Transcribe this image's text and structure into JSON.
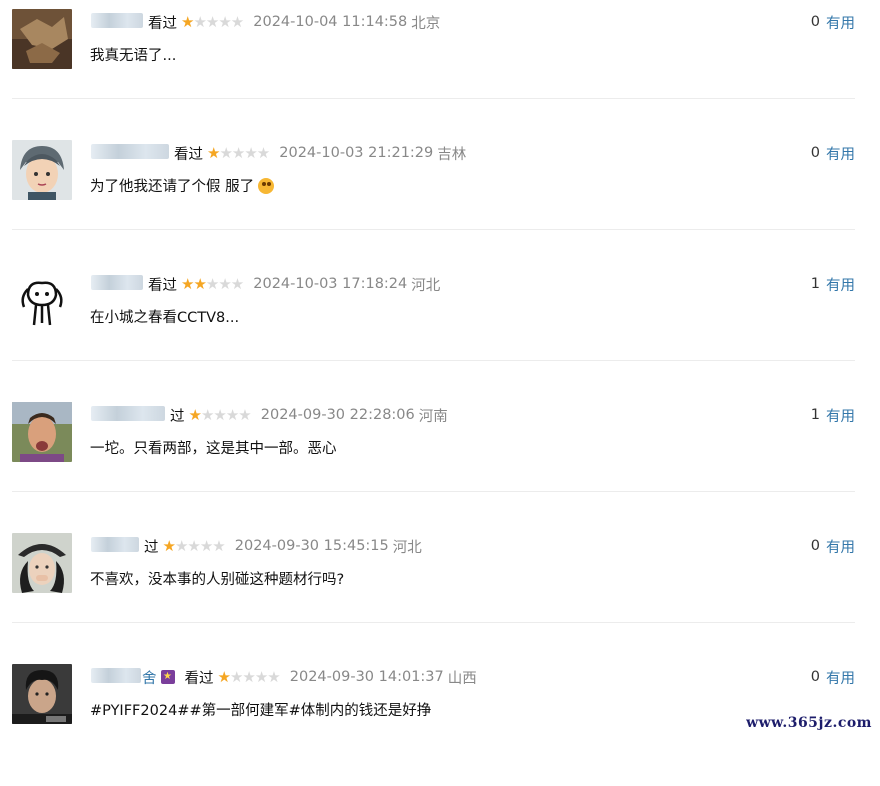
{
  "reviews": [
    {
      "name_visible": "",
      "status": "看过",
      "rating": 1,
      "time": "2024-10-04 11:14:58",
      "location": "北京",
      "votes": "0",
      "vote_label": "有用",
      "comment": "我真无语了..."
    },
    {
      "name_visible": "",
      "status": "看过",
      "rating": 1,
      "time": "2024-10-03 21:21:29",
      "location": "吉林",
      "votes": "0",
      "vote_label": "有用",
      "comment": "为了他我还请了个假 服了"
    },
    {
      "name_visible": "",
      "status": "看过",
      "rating": 2,
      "time": "2024-10-03 17:18:24",
      "location": "河北",
      "votes": "1",
      "vote_label": "有用",
      "comment": "在小城之春看CCTV8..."
    },
    {
      "name_visible": "",
      "status": "过",
      "rating": 1,
      "time": "2024-09-30 22:28:06",
      "location": "河南",
      "votes": "1",
      "vote_label": "有用",
      "comment": "一坨。只看两部，这是其中一部。恶心"
    },
    {
      "name_visible": "",
      "status": "过",
      "rating": 1,
      "time": "2024-09-30 15:45:15",
      "location": "河北",
      "votes": "0",
      "vote_label": "有用",
      "comment": "不喜欢，没本事的人别碰这种题材行吗?"
    },
    {
      "name_visible": "舍",
      "status": "看过",
      "rating": 1,
      "time": "2024-09-30 14:01:37",
      "location": "山西",
      "votes": "0",
      "vote_label": "有用",
      "comment": "#PYIFF2024##第一部何建军#体制内的钱还是好挣"
    }
  ],
  "watermark": "www.365jz.com"
}
